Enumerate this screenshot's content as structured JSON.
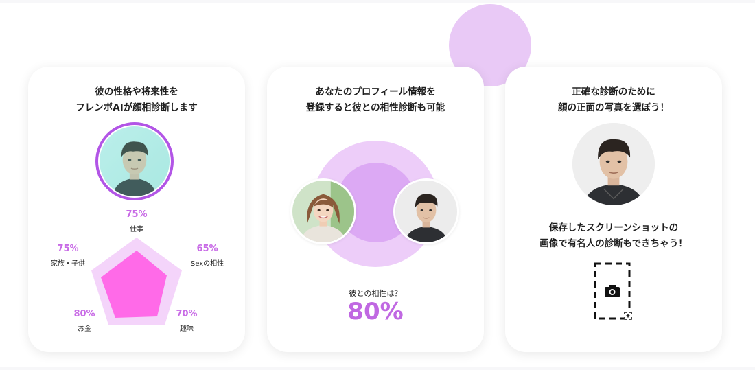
{
  "cards": [
    {
      "title_line1": "彼の性格や将来性を",
      "title_line2": "フレンボAIが顔相診断します",
      "radar": {
        "axes": [
          {
            "label": "仕事",
            "value": "75%"
          },
          {
            "label": "Sexの相性",
            "value": "65%"
          },
          {
            "label": "趣味",
            "value": "70%"
          },
          {
            "label": "お金",
            "value": "80%"
          },
          {
            "label": "家族・子供",
            "value": "75%"
          }
        ]
      }
    },
    {
      "title_line1": "あなたのプロフィール情報を",
      "title_line2": "登録すると彼との相性診断も可能",
      "compat_label": "彼との相性は？",
      "compat_value": "80%"
    },
    {
      "title_line1": "正確な診断のために",
      "title_line2": "顔の正面の写真を選ぼう！",
      "text2_line1": "保存したスクリーンショットの",
      "text2_line2": "画像で有名人の診断もできちゃう！",
      "icon": "screenshot-camera-icon"
    }
  ],
  "colors": {
    "accent_purple": "#c068e2",
    "radar_fill": "#ff6ae8",
    "radar_bg": "#f4d4fa",
    "circle_outer": "#edcdf9",
    "circle_inner": "#dca9f4",
    "deco_circle": "#e9c9f6"
  }
}
